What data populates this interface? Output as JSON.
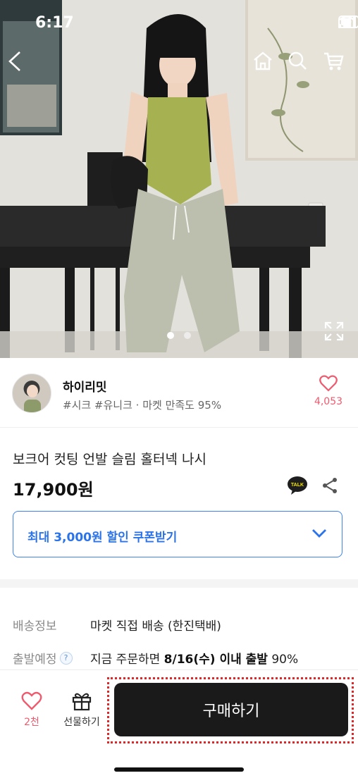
{
  "status_bar": {
    "time": "6:17"
  },
  "nav": {
    "back_icon": "chevron-left-icon",
    "home_icon": "home-icon",
    "search_icon": "search-icon",
    "cart_icon": "cart-icon"
  },
  "gallery": {
    "image_count": 2,
    "active_index": 0
  },
  "seller": {
    "name": "하이리밋",
    "tags": "#시크 #유니크 · 마켓 만족도 95%",
    "like_count": "4,053"
  },
  "product": {
    "title": "보크어 컷팅 언발 슬림 홀터넥 나시",
    "price": "17,900원",
    "talk_badge": "TALK"
  },
  "coupon": {
    "label": "최대 3,000원 할인 쿠폰받기"
  },
  "shipping": {
    "info_label": "배송정보",
    "info_value": "마켓 직접 배송 (한진택배)",
    "eta_label": "출발예정",
    "eta_help": "?",
    "eta_prefix": "지금 주문하면 ",
    "eta_bold": "8/16(수) 이내 출발",
    "eta_suffix": " 90%"
  },
  "bottom_bar": {
    "like_label": "2천",
    "gift_label": "선물하기",
    "buy_label": "구매하기"
  },
  "colors": {
    "accent_red": "#f05a6e",
    "coupon_blue": "#2b73e8",
    "buy_button": "#1a1a1a",
    "highlight_outline": "#e02626"
  }
}
